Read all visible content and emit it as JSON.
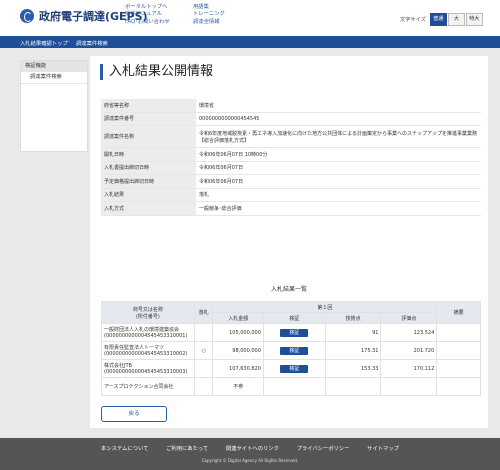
{
  "header": {
    "logo_text": "政府電子調達(GEPS)",
    "links_col1": [
      "ポータルトップへ",
      "操作マニュアル",
      "FAQ･お問い合わせ"
    ],
    "links_col2": [
      "用語集",
      "トレーニング",
      "調達全情報"
    ],
    "font_size": {
      "label": "文字サイズ",
      "options": [
        "普通",
        "大",
        "特大"
      ],
      "selected": "普通"
    }
  },
  "breadcrumb": {
    "items": [
      "入札結果確認トップ",
      "調達案件検索"
    ],
    "separator": "›"
  },
  "sidebar": {
    "heading": "検証機能",
    "items": [
      "調達案件検索"
    ]
  },
  "page_title": "入札結果公開情報",
  "info": {
    "rows": [
      {
        "label": "府省等名称",
        "value": "環境省"
      },
      {
        "label": "調達案件番号",
        "value": "0000000000000454545"
      },
      {
        "label": "調達案件名称",
        "value": "令和6年度地域脱炭素・再エネ導入加速化に向けた地方公共団体による計画策定から事業へのステップアップを推進事業業務【総合評価落札方式】"
      },
      {
        "label": "開札日時",
        "value": "令和06年06月07日 10時00分"
      },
      {
        "label": "入札書提出締切日時",
        "value": "令和06年06月07日"
      },
      {
        "label": "予定価格提出締切日時",
        "value": "令和06年06月07日"
      },
      {
        "label": "入札結果",
        "value": "落札"
      },
      {
        "label": "入札方式",
        "value": "一般競争･総合評価"
      }
    ]
  },
  "results": {
    "title": "入札結果一覧",
    "headers": {
      "company": "商号又は名称\n(所付番号)",
      "award": "落札",
      "round": "第１回",
      "amount": "入札金額",
      "verify": "検証",
      "tech_score": "技術点",
      "eval_score": "評価点",
      "remarks": "摘要"
    },
    "rows": [
      {
        "name": "一般財団法人入札の環境建築協会",
        "code": "(0000000000004545453310001)",
        "award": "",
        "amount": "105,000,000",
        "verify": "検証",
        "tech": "91",
        "eval": "123.524",
        "remarks": ""
      },
      {
        "name": "有限責任監査法人トーマツ",
        "code": "(0000000000004545453310002)",
        "award": "○",
        "amount": "98,000,000",
        "verify": "検証",
        "tech": "175.31",
        "eval": "201.720",
        "remarks": ""
      },
      {
        "name": "株式会社JTB",
        "code": "(0000000000004545453310003)",
        "award": "",
        "amount": "107,630,820",
        "verify": "検証",
        "tech": "153.33",
        "eval": "170.112",
        "remarks": ""
      },
      {
        "name": "アースプロテクション合同会社",
        "code": "",
        "award": "",
        "amount": "不参",
        "verify": "",
        "tech": "",
        "eval": "",
        "remarks": ""
      }
    ]
  },
  "back_button": "戻る",
  "footer": {
    "links": [
      "本システムについて",
      "ご利用にあたって",
      "関連サイトへのリンク",
      "プライバシーポリシー",
      "サイトマップ"
    ],
    "copyright": "Copyright © Digital Agency All Rights Reserved."
  }
}
